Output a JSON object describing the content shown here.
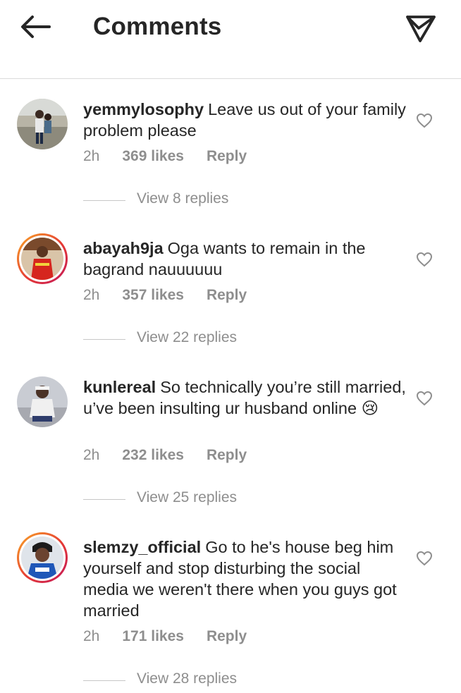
{
  "header": {
    "title": "Comments",
    "back_icon": "arrow-left-icon",
    "share_icon": "paper-plane-icon"
  },
  "comments": [
    {
      "username": "yemmylosophy",
      "text": "Leave us out of your family problem please",
      "time": "2h",
      "likes": "369 likes",
      "reply": "Reply",
      "view_replies": "View 8 replies",
      "avatar_story_ring": false
    },
    {
      "username": "abayah9ja",
      "text": "Oga wants to remain in the bagrand nauuuuuu",
      "time": "2h",
      "likes": "357 likes",
      "reply": "Reply",
      "view_replies": "View 22 replies",
      "avatar_story_ring": true
    },
    {
      "username": "kunlereal",
      "text": "So technically you’re still married, u’ve been insulting ur husband online 😢",
      "time": "2h",
      "likes": "232 likes",
      "reply": "Reply",
      "view_replies": "View 25 replies",
      "avatar_story_ring": false
    },
    {
      "username": "slemzy_official",
      "text": "Go to he's house beg him yourself and stop disturbing the social media we weren't there when you guys got married",
      "time": "2h",
      "likes": "171 likes",
      "reply": "Reply",
      "view_replies": "View 28 replies",
      "avatar_story_ring": true
    }
  ],
  "colors": {
    "text": "#262626",
    "muted": "#8e8e8e",
    "divider": "#dbdbdb",
    "ring_start": "#f9a825",
    "ring_end": "#c2185b"
  }
}
